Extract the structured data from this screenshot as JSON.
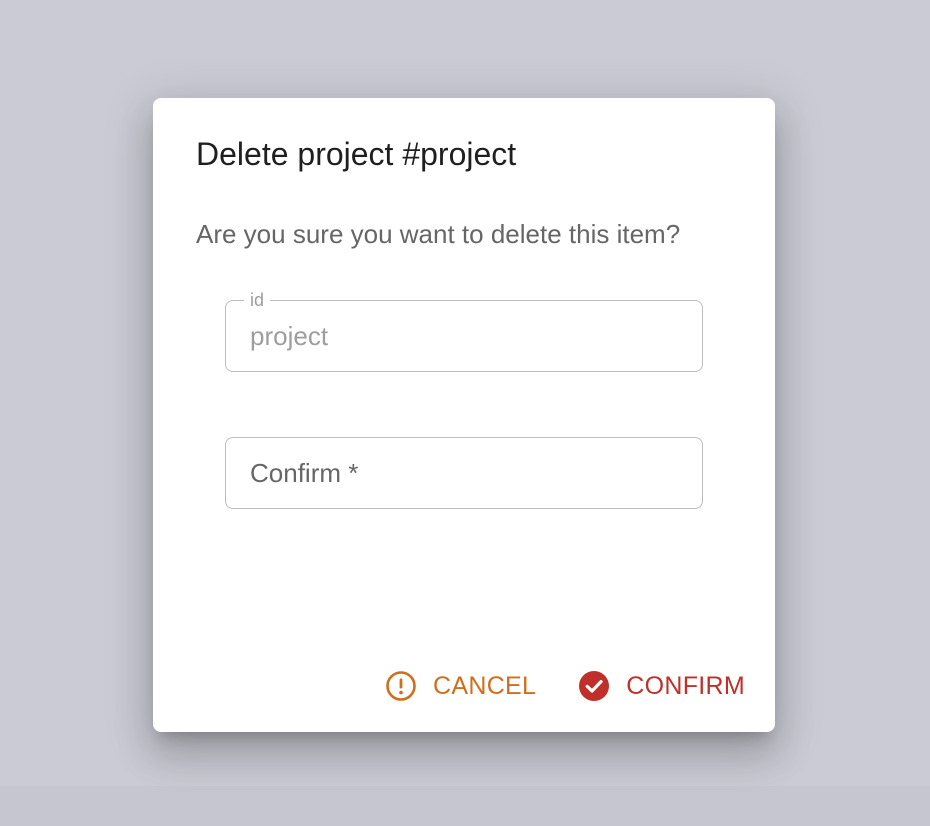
{
  "dialog": {
    "title": "Delete project #project",
    "message": "Are you sure you want to delete this item?"
  },
  "fields": {
    "id": {
      "label": "id",
      "value": "project"
    },
    "confirm": {
      "placeholder": "Confirm *",
      "value": ""
    }
  },
  "actions": {
    "cancel_label": "CANCEL",
    "confirm_label": "CONFIRM",
    "cancel_icon": "alert-circle-icon",
    "confirm_icon": "check-circle-icon"
  },
  "colors": {
    "cancel": "#cf6f1e",
    "confirm": "#c0302a",
    "backdrop": "#cbcbd5"
  }
}
